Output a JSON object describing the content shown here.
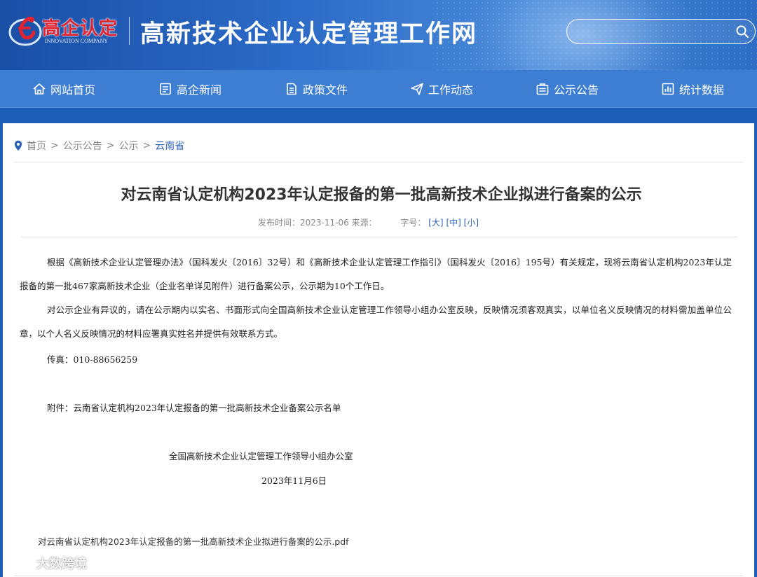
{
  "colors": {
    "header_bg": "#2c6cc8",
    "nav_bg": "#3e7ed2",
    "accent_link": "#2c63b6",
    "logo_red": "#e0232f",
    "text": "#222222"
  },
  "header": {
    "logo_cn": "高企认定",
    "logo_en": "INNOVATION COMPANY",
    "site_title": "高新技术企业认定管理工作网",
    "search": {
      "placeholder": "",
      "icon": "search-icon"
    }
  },
  "nav": {
    "items": [
      {
        "label": "网站首页",
        "icon": "home-icon"
      },
      {
        "label": "高企新闻",
        "icon": "news-icon"
      },
      {
        "label": "政策文件",
        "icon": "document-icon"
      },
      {
        "label": "工作动态",
        "icon": "send-icon"
      },
      {
        "label": "公示公告",
        "icon": "notice-icon"
      },
      {
        "label": "统计数据",
        "icon": "chart-icon"
      }
    ]
  },
  "breadcrumb": {
    "items": [
      "首页",
      "公示公告",
      "公示",
      "云南省"
    ],
    "separator": ">"
  },
  "article": {
    "title": "对云南省认定机构2023年认定报备的第一批高新技术企业拟进行备案的公示",
    "meta": {
      "publish_label": "发布时间：2023-11-06 来源：",
      "font_size_label": "字号：",
      "font_sizes": [
        "[大]",
        "[中]",
        "[小]"
      ]
    },
    "paragraphs": [
      "根据《高新技术企业认定管理办法》（国科发火〔2016〕32号）和《高新技术企业认定管理工作指引》（国科发火〔2016〕195号）有关规定，现将云南省认定机构2023年认定报备的第一批467家高新技术企业（企业名单详见附件）进行备案公示，公示期为10个工作日。",
      "对公示企业有异议的，请在公示期内以实名、书面形式向全国高新技术企业认定管理工作领导小组办公室反映，反映情况须客观真实，以单位名义反映情况的材料需加盖单位公章，以个人名义反映情况的材料应署真实姓名并提供有效联系方式。"
    ],
    "fax": "传真：010-88656259",
    "attachment_text": "附件：云南省认定机构2023年认定报备的第一批高新技术企业备案公示名单",
    "signature_org": "全国高新技术企业认定管理工作领导小组办公室",
    "signature_date": "2023年11月6日",
    "attachment_file": "对云南省认定机构2023年认定报备的第一批高新技术企业拟进行备案的公示.pdf"
  },
  "watermark": {
    "text": "大数跨境"
  }
}
